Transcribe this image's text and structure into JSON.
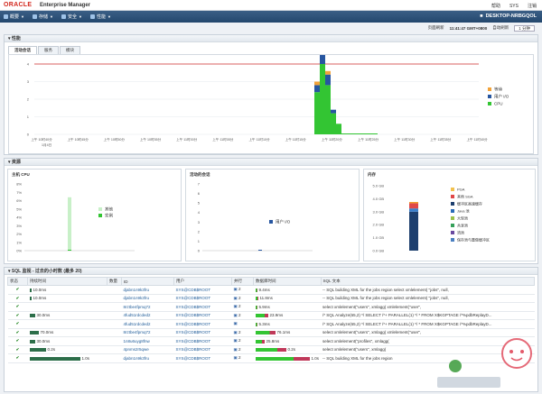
{
  "header": {
    "logo": "ORACLE",
    "app": "Enterprise Manager",
    "help": "帮助",
    "user": "SYS",
    "logout": "注销",
    "host": "DESKTOP-NRBGQOL"
  },
  "menus": [
    {
      "label": "概要"
    },
    {
      "label": "存储"
    },
    {
      "label": "安全"
    },
    {
      "label": "性能"
    }
  ],
  "timebar": {
    "label": "页面刷新",
    "time": "11:41:47 GMT+0800",
    "refresh_label": "自动刷新",
    "interval": "1 分钟"
  },
  "performance": {
    "title": "性能",
    "tabs": [
      "活动会话",
      "服务",
      "模块"
    ],
    "legend": [
      "等待",
      "用户 I/O",
      "CPU"
    ],
    "xticks": [
      "上午 10时40分",
      "上午 10时45分",
      "上午 10时50分",
      "上午 10时55分",
      "上午 11时00分",
      "上午 11时05分",
      "上午 11时10分",
      "上午 11时15分",
      "上午 11时20分",
      "上午 11时25分",
      "上午 11时30分",
      "上午 11时35分",
      "上午 11时40分"
    ],
    "xdate": "1月4日",
    "yticks": [
      "4",
      "3",
      "2",
      "1",
      "0"
    ]
  },
  "resources": {
    "title": "资源",
    "cpu": {
      "title": "主机 CPU",
      "yticks": [
        "8%",
        "7%",
        "6%",
        "5%",
        "4%",
        "3%",
        "2%",
        "1%",
        "0%"
      ],
      "legend": [
        "其他",
        "实例"
      ]
    },
    "sessions": {
      "title": "活动的会话",
      "yticks": [
        "7",
        "6",
        "5",
        "4",
        "3",
        "2",
        "1",
        "0"
      ],
      "legend": [
        "用户 I/O"
      ]
    },
    "memory": {
      "title": "内存",
      "yticks": [
        "5.0 GB",
        "4.0 GB",
        "3.0 GB",
        "2.0 GB",
        "1.0 GB",
        "0.0 GB"
      ],
      "legend": [
        "PGA",
        "其他 SGA",
        "缓冲区高速缓存",
        "Java 池",
        "大型池",
        "共享池",
        "流池",
        "保存池与重做缓冲区"
      ]
    }
  },
  "sql": {
    "title": "SQL 监视 - 过去的小时数 (最多 20)",
    "columns": [
      "状态",
      "持续时间",
      "数量",
      "ID",
      "用户",
      "并行",
      "数据库时间",
      "SQL 文本"
    ],
    "rows": [
      {
        "dur": "10.0ms",
        "id": "djabn1n9k3fru",
        "user": "SYS@CDB$ROOT",
        "par": "2",
        "dbt": "9.4ms",
        "sql": "-- SQL building XML for the jobs region    select    xmlelement(     \"jobs\",     null,"
      },
      {
        "dur": "10.0ms",
        "id": "djabn1n9k3fru",
        "user": "SYS@CDB$ROOT",
        "par": "2",
        "dbt": "11.8ms",
        "sql": "-- SQL building XML for the jobs region    select    xmlelement(     \"jobs\",     null,"
      },
      {
        "dur": "",
        "id": "8rztbe4fpmq72",
        "user": "SYS@CDB$ROOT",
        "par": "2",
        "dbt": "5.9ms",
        "sql": "select     xmlelement(\"users\",      xmlagg(      xmlelement(\"user\","
      },
      {
        "dur": "30.0ms",
        "id": "4fud51rdcded2",
        "user": "SYS@CDB$ROOT",
        "par": "2",
        "dbt": "23.9ms",
        "sql": "/* SQL Analyze(65,2) */ SELECT /*+ PARALLEL(1) */ * FROM X$KGPTAGE /*%pdbReplayD..."
      },
      {
        "dur": "",
        "id": "4fud51rdcded2",
        "user": "SYS@CDB$ROOT",
        "par": "",
        "dbt": "5.3ms",
        "sql": "/* SQL Analyze(65,2) */ SELECT /*+ PARALLEL(1) */ * FROM X$KGPTAGE /*%pdbReplayD..."
      },
      {
        "dur": "70.0ms",
        "id": "8rztbe4fpmq72",
        "user": "SYS@CDB$ROOT",
        "par": "2",
        "dbt": "76.1ms",
        "sql": "select     xmlelement(\"users\",      xmlagg(      xmlelement(\"user\","
      },
      {
        "dur": "30.0ms",
        "id": "1n8u6uyg8fnw",
        "user": "SYS@CDB$ROOT",
        "par": "2",
        "dbt": "25.8ms",
        "sql": "select xmlelement(\"profiles\",     xmlagg("
      },
      {
        "dur": "0.2s",
        "id": "4pnms2r5qwe",
        "user": "SYS@CDB$ROOT",
        "par": "2",
        "dbt": "0.2s",
        "sql": "select     xmlelement(\"users\",      xmlagg("
      },
      {
        "dur": "1.0s",
        "id": "djabn1n9k3fru",
        "user": "SYS@CDB$ROOT",
        "par": "2",
        "dbt": "1.0s",
        "sql": "-- SQL building XML for the jobs region"
      }
    ]
  },
  "colors": {
    "wait": "#f2a33a",
    "userio": "#2756a0",
    "cpu": "#33c533",
    "other": "#c8f0c8",
    "redline": "#d03030"
  }
}
